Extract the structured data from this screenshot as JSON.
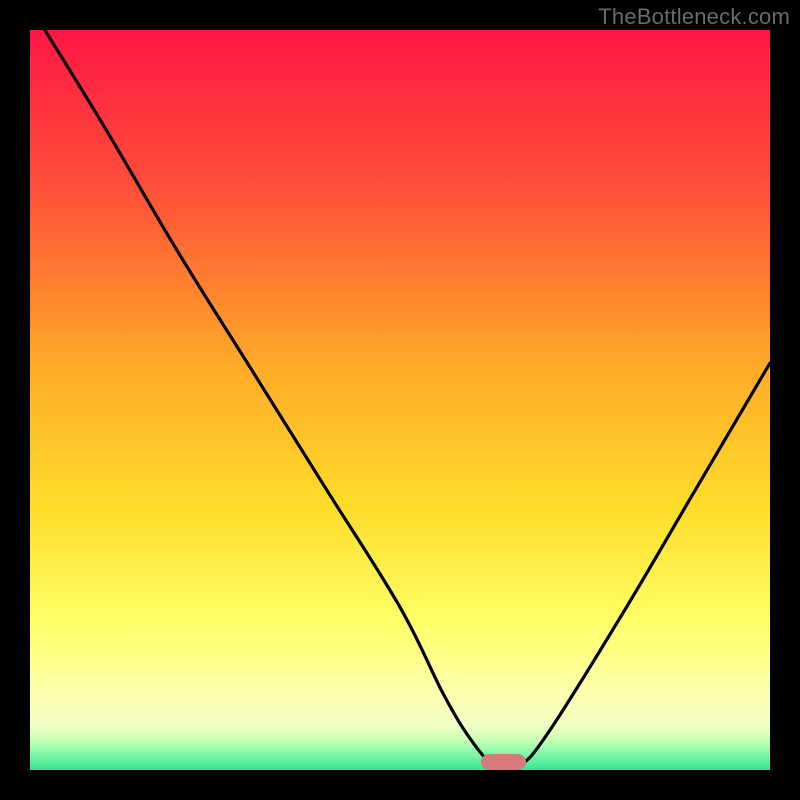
{
  "watermark": "TheBottleneck.com",
  "chart_data": {
    "type": "line",
    "title": "",
    "xlabel": "",
    "ylabel": "",
    "xlim": [
      0,
      100
    ],
    "ylim": [
      0,
      100
    ],
    "grid": false,
    "legend": false,
    "series": [
      {
        "name": "bottleneck-curve",
        "x": [
          2,
          10,
          20,
          30,
          40,
          50,
          56,
          60,
          63,
          66,
          70,
          80,
          90,
          100
        ],
        "values": [
          100,
          87,
          70,
          54,
          38,
          22,
          10,
          3.5,
          0.5,
          0.5,
          5,
          21,
          38,
          55
        ]
      }
    ],
    "optimal_marker": {
      "x_center": 64,
      "width": 6,
      "height": 2.2
    },
    "gradient_stops": [
      {
        "pos": 0,
        "color": "#ff1745"
      },
      {
        "pos": 22,
        "color": "#ff5138"
      },
      {
        "pos": 45,
        "color": "#ffa928"
      },
      {
        "pos": 65,
        "color": "#ffde2b"
      },
      {
        "pos": 80,
        "color": "#feff67"
      },
      {
        "pos": 90,
        "color": "#fdffb0"
      },
      {
        "pos": 94,
        "color": "#f0ffc5"
      },
      {
        "pos": 96,
        "color": "#c6ffb5"
      },
      {
        "pos": 98,
        "color": "#7cf7a6"
      },
      {
        "pos": 100,
        "color": "#34e58f"
      }
    ]
  }
}
